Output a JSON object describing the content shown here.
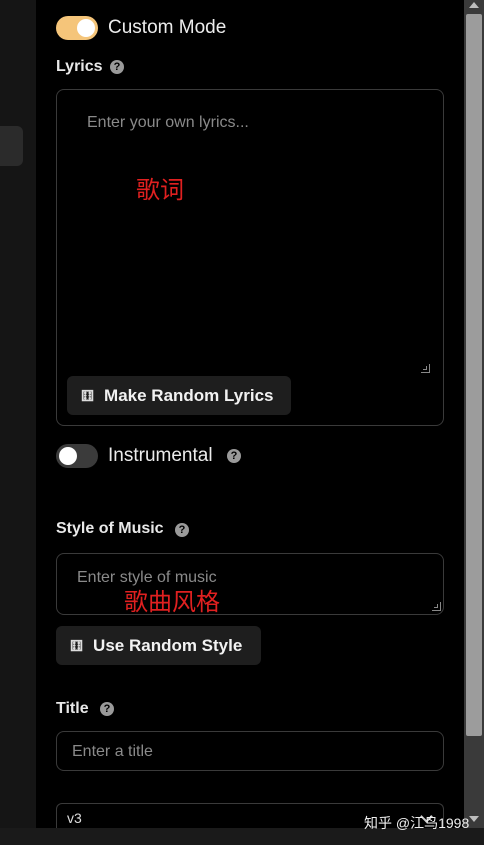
{
  "custom_mode": {
    "label": "Custom Mode",
    "state": "on"
  },
  "lyrics": {
    "label": "Lyrics",
    "help": "?",
    "placeholder": "Enter your own lyrics...",
    "annotation": "歌词",
    "random_button": "Make Random Lyrics"
  },
  "instrumental": {
    "label": "Instrumental",
    "state": "off",
    "help": "?"
  },
  "style": {
    "label": "Style of Music",
    "help": "?",
    "placeholder": "Enter style of music",
    "annotation": "歌曲风格",
    "random_button": "Use Random Style"
  },
  "title": {
    "label": "Title",
    "help": "?",
    "placeholder": "Enter a title"
  },
  "version": {
    "value": "v3"
  },
  "watermark": "知乎 @江鸟1998",
  "colors": {
    "toggle_on": "#f5c57a",
    "toggle_off": "#3b3b3b",
    "annotation": "#e02020"
  },
  "icons": [
    "dice-icon",
    "help-icon",
    "chevron-down-icon"
  ]
}
